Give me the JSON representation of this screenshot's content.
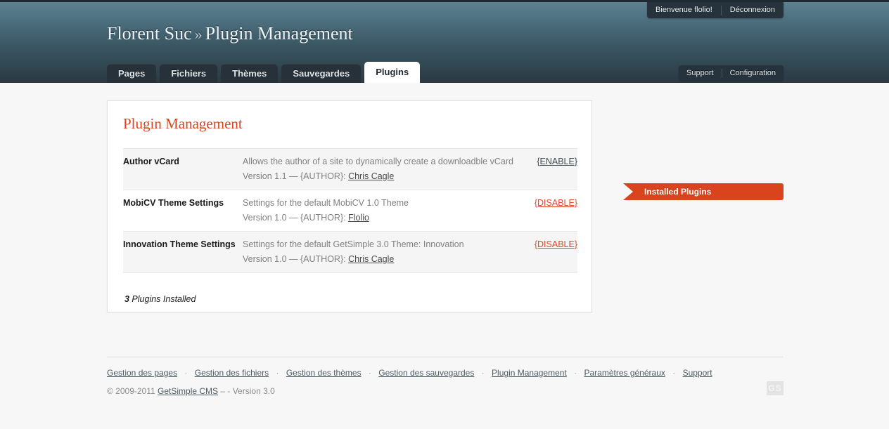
{
  "topbar": {
    "welcome_label": "Bienvenue flolio!",
    "logout_label": "Déconnexion"
  },
  "header": {
    "site_name": "Florent Suc",
    "separator": "»",
    "page_name": "Plugin Management"
  },
  "nav": {
    "tabs": [
      {
        "label": "Pages",
        "active": false
      },
      {
        "label": "Fichiers",
        "active": false
      },
      {
        "label": "Thèmes",
        "active": false
      },
      {
        "label": "Sauvegardes",
        "active": false
      },
      {
        "label": "Plugins",
        "active": true
      }
    ],
    "right": {
      "support_label": "Support",
      "configuration_label": "Configuration"
    }
  },
  "panel": {
    "title": "Plugin Management",
    "rows": [
      {
        "name": "Author vCard",
        "description": "Allows the author of a site to dynamically create a downloadble vCard",
        "version_prefix": "Version 1.1 — {AUTHOR}: ",
        "author": "Chris Cagle",
        "action_label": "{ENABLE}",
        "action_state": "enable"
      },
      {
        "name": "MobiCV Theme Settings",
        "description": "Settings for the default MobiCV 1.0 Theme",
        "version_prefix": "Version 1.0 — {AUTHOR}: ",
        "author": "Flolio",
        "action_label": "{DISABLE}",
        "action_state": "disable"
      },
      {
        "name": "Innovation Theme Settings",
        "description": "Settings for the default GetSimple 3.0 Theme: Innovation",
        "version_prefix": "Version 1.0 — {AUTHOR}: ",
        "author": "Chris Cagle",
        "action_label": "{DISABLE}",
        "action_state": "disable"
      }
    ],
    "count_number": "3",
    "count_label": " Plugins Installed"
  },
  "sidebar": {
    "badge_label": "Installed Plugins"
  },
  "footer": {
    "links": [
      "Gestion des pages",
      "Gestion des fichiers",
      "Gestion des thèmes",
      "Gestion des sauvegardes",
      "Plugin Management",
      "Paramètres généraux",
      "Support"
    ],
    "separator": "·",
    "copyright_prefix": "© 2009-2011 ",
    "copyright_link": "GetSimple CMS",
    "copyright_suffix": " – - Version 3.0",
    "logo_text": "GS"
  },
  "colors": {
    "accent": "#d9441f",
    "header_top": "#5d8190",
    "header_bottom": "#2b3942",
    "disable_link": "#e2452a"
  }
}
